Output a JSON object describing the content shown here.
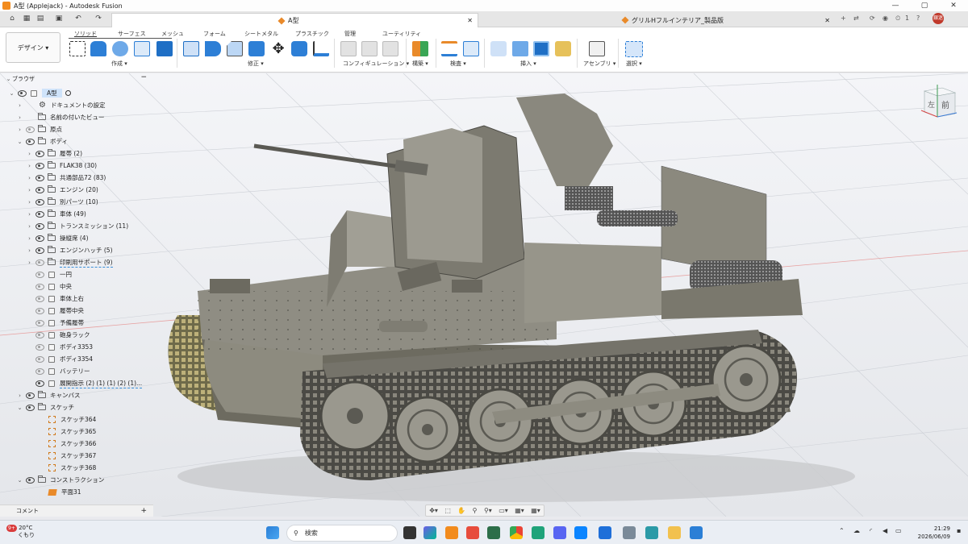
{
  "window": {
    "title": "A型 (Applejack) - Autodesk Fusion",
    "controls": [
      "—",
      "▢",
      "✕"
    ]
  },
  "doc_tabs": [
    {
      "label": "A型",
      "close": "✕",
      "active": true
    },
    {
      "label": "グリルHフルインテリア_製品版",
      "close": "✕",
      "active": false
    }
  ],
  "top_right": {
    "count": "1",
    "user": "銀迷"
  },
  "ribbon": {
    "workspace": "デザイン ▾",
    "tabs": [
      "ソリッド",
      "サーフェス",
      "メッシュ",
      "フォーム",
      "シートメタル",
      "プラスチック",
      "管理",
      "ユーティリティ"
    ],
    "groups": [
      "作成 ▾",
      "修正 ▾",
      "コンフィギュレーション ▾",
      "構築 ▾",
      "検査 ▾",
      "挿入 ▾",
      "アセンブリ ▾",
      "選択 ▾"
    ]
  },
  "browser": {
    "title": "ブラウザ",
    "collapse": "−",
    "root": "A型",
    "items": [
      {
        "label": "ドキュメントの設定",
        "type": "gear",
        "indent": 1,
        "chev": "›",
        "eye": "none"
      },
      {
        "label": "名前の付いたビュー",
        "type": "folder",
        "indent": 1,
        "chev": "›",
        "eye": "none"
      },
      {
        "label": "原点",
        "type": "folder",
        "indent": 1,
        "chev": "›",
        "eye": "off"
      },
      {
        "label": "ボディ",
        "type": "folder",
        "indent": 1,
        "chev": "⌄",
        "eye": "on"
      },
      {
        "label": "履帯 (2)",
        "type": "folder",
        "indent": 2,
        "chev": "›",
        "eye": "on"
      },
      {
        "label": "FLAK38 (30)",
        "type": "folder",
        "indent": 2,
        "chev": "›",
        "eye": "on"
      },
      {
        "label": "共通部品72 (83)",
        "type": "folder",
        "indent": 2,
        "chev": "›",
        "eye": "on"
      },
      {
        "label": "エンジン (20)",
        "type": "folder",
        "indent": 2,
        "chev": "›",
        "eye": "on"
      },
      {
        "label": "別パーツ (10)",
        "type": "folder",
        "indent": 2,
        "chev": "›",
        "eye": "on"
      },
      {
        "label": "車体 (49)",
        "type": "folder",
        "indent": 2,
        "chev": "›",
        "eye": "on"
      },
      {
        "label": "トランスミッション (11)",
        "type": "folder",
        "indent": 2,
        "chev": "›",
        "eye": "on"
      },
      {
        "label": "操縦席 (4)",
        "type": "folder",
        "indent": 2,
        "chev": "›",
        "eye": "on"
      },
      {
        "label": "エンジンハッチ (5)",
        "type": "folder",
        "indent": 2,
        "chev": "›",
        "eye": "on"
      },
      {
        "label": "印刷用サポート (9)",
        "type": "folder",
        "indent": 2,
        "chev": "›",
        "eye": "off",
        "wave": true
      },
      {
        "label": "一円",
        "type": "body",
        "indent": 2,
        "chev": "",
        "eye": "off"
      },
      {
        "label": "中央",
        "type": "body",
        "indent": 2,
        "chev": "",
        "eye": "off"
      },
      {
        "label": "車体上右",
        "type": "body",
        "indent": 2,
        "chev": "",
        "eye": "off"
      },
      {
        "label": "履帯中央",
        "type": "body",
        "indent": 2,
        "chev": "",
        "eye": "off"
      },
      {
        "label": "予備履帯",
        "type": "body",
        "indent": 2,
        "chev": "",
        "eye": "off"
      },
      {
        "label": "砲身ラック",
        "type": "body",
        "indent": 2,
        "chev": "",
        "eye": "off"
      },
      {
        "label": "ボディ3353",
        "type": "body",
        "indent": 2,
        "chev": "",
        "eye": "off"
      },
      {
        "label": "ボディ3354",
        "type": "body",
        "indent": 2,
        "chev": "",
        "eye": "off"
      },
      {
        "label": "バッテリー",
        "type": "body",
        "indent": 2,
        "chev": "",
        "eye": "off"
      },
      {
        "label": "展開指示 (2) (1) (1) (2) (1)...",
        "type": "body",
        "indent": 2,
        "chev": "",
        "eye": "on",
        "wave": true
      },
      {
        "label": "キャンバス",
        "type": "folder",
        "indent": 1,
        "chev": "›",
        "eye": "on"
      },
      {
        "label": "スケッチ",
        "type": "folder",
        "indent": 1,
        "chev": "⌄",
        "eye": "on"
      },
      {
        "label": "スケッチ364",
        "type": "sketch",
        "indent": 2,
        "chev": "",
        "eye": "none"
      },
      {
        "label": "スケッチ365",
        "type": "sketch",
        "indent": 2,
        "chev": "",
        "eye": "none"
      },
      {
        "label": "スケッチ366",
        "type": "sketch",
        "indent": 2,
        "chev": "",
        "eye": "none"
      },
      {
        "label": "スケッチ367",
        "type": "sketch",
        "indent": 2,
        "chev": "",
        "eye": "none"
      },
      {
        "label": "スケッチ368",
        "type": "sketch",
        "indent": 2,
        "chev": "",
        "eye": "none"
      },
      {
        "label": "コンストラクション",
        "type": "folder",
        "indent": 1,
        "chev": "⌄",
        "eye": "on"
      },
      {
        "label": "平面31",
        "type": "plane",
        "indent": 2,
        "chev": "",
        "eye": "none"
      }
    ]
  },
  "comments": {
    "label": "コメント",
    "add": "+"
  },
  "viewcube": {
    "left": "左",
    "front": "前"
  },
  "navbar": [
    "✥▾",
    "⬚",
    "✋",
    "⚲",
    "⚲▾",
    "▭▾",
    "▦▾",
    "▦▾"
  ],
  "taskbar": {
    "weather_temp": "20°C",
    "weather_desc": "くもり",
    "badge": "9+",
    "search": "検索",
    "time": "21:29",
    "date": "2026/06/09"
  }
}
